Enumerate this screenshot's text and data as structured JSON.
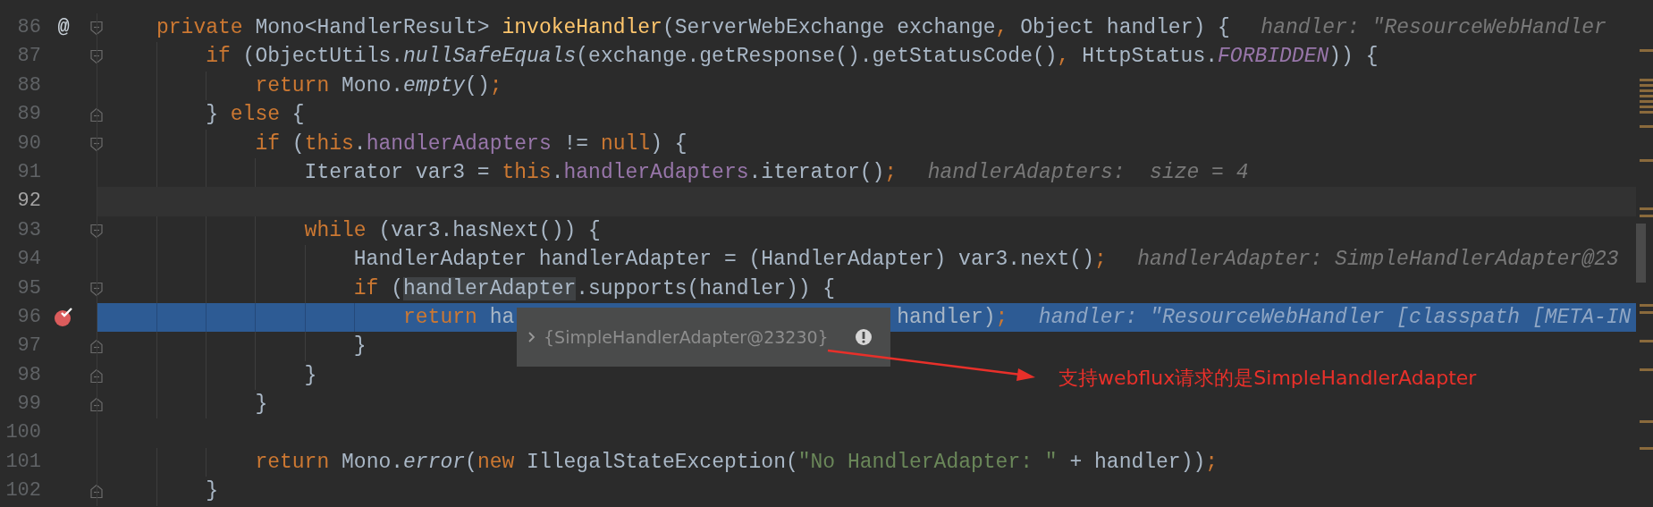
{
  "editor": {
    "lines": [
      {
        "number": "86",
        "gutter_mark": "@",
        "fold_start": true,
        "tokens": [
          {
            "kind": "kw",
            "text": "private"
          },
          {
            "kind": "txt",
            "text": " Mono<HandlerResult> "
          },
          {
            "kind": "decl",
            "text": "invokeHandler"
          },
          {
            "kind": "txt",
            "text": "(ServerWebExchange exchange"
          },
          {
            "kind": "punct",
            "text": ","
          },
          {
            "kind": "txt",
            "text": " Object handler) {"
          }
        ],
        "hint": "handler: \"ResourceWebHandler"
      },
      {
        "number": "87",
        "fold_start": true,
        "tokens": [
          {
            "kind": "kw",
            "text": "    if"
          },
          {
            "kind": "txt",
            "text": " (ObjectUtils."
          },
          {
            "kind": "static",
            "text": "nullSafeEquals"
          },
          {
            "kind": "txt",
            "text": "(exchange.getResponse().getStatusCode()"
          },
          {
            "kind": "punct",
            "text": ","
          },
          {
            "kind": "txt",
            "text": " HttpStatus."
          },
          {
            "kind": "constant",
            "text": "FORBIDDEN"
          },
          {
            "kind": "txt",
            "text": ")) {"
          }
        ]
      },
      {
        "number": "88",
        "tokens": [
          {
            "kind": "kw",
            "text": "        return"
          },
          {
            "kind": "txt",
            "text": " Mono."
          },
          {
            "kind": "static",
            "text": "empty"
          },
          {
            "kind": "txt",
            "text": "()"
          },
          {
            "kind": "punct",
            "text": ";"
          }
        ]
      },
      {
        "number": "89",
        "fold_end": true,
        "tokens": [
          {
            "kind": "txt",
            "text": "    } "
          },
          {
            "kind": "kw",
            "text": "else"
          },
          {
            "kind": "txt",
            "text": " {"
          }
        ]
      },
      {
        "number": "90",
        "fold_start": true,
        "tokens": [
          {
            "kind": "kw",
            "text": "        if"
          },
          {
            "kind": "txt",
            "text": " ("
          },
          {
            "kind": "kw",
            "text": "this"
          },
          {
            "kind": "txt",
            "text": "."
          },
          {
            "kind": "field",
            "text": "handlerAdapters"
          },
          {
            "kind": "txt",
            "text": " != "
          },
          {
            "kind": "kw",
            "text": "null"
          },
          {
            "kind": "txt",
            "text": ") {"
          }
        ]
      },
      {
        "number": "91",
        "tokens": [
          {
            "kind": "txt",
            "text": "            Iterator var3 = "
          },
          {
            "kind": "kw",
            "text": "this"
          },
          {
            "kind": "txt",
            "text": "."
          },
          {
            "kind": "field",
            "text": "handlerAdapters"
          },
          {
            "kind": "txt",
            "text": ".iterator()"
          },
          {
            "kind": "punct",
            "text": ";"
          }
        ],
        "hint": "handlerAdapters:  size = 4"
      },
      {
        "number": "92",
        "caret_line": true
      },
      {
        "number": "93",
        "fold_start": true,
        "tokens": [
          {
            "kind": "kw",
            "text": "            while"
          },
          {
            "kind": "txt",
            "text": " (var3.hasNext()) {"
          }
        ]
      },
      {
        "number": "94",
        "tokens": [
          {
            "kind": "txt",
            "text": "                HandlerAdapter handlerAdapter = (HandlerAdapter) var3.next()"
          },
          {
            "kind": "punct",
            "text": ";"
          }
        ],
        "hint": "handlerAdapter: SimpleHandlerAdapter@23"
      },
      {
        "number": "95",
        "fold_start": true,
        "tokens": [
          {
            "kind": "kw",
            "text": "                if"
          },
          {
            "kind": "txt",
            "text": " ("
          },
          {
            "kind": "hovered",
            "text": "handlerAdapter"
          },
          {
            "kind": "txt",
            "text": ".supports(handler)) {"
          }
        ]
      },
      {
        "number": "96",
        "execution_point": true,
        "breakpoint": true,
        "tokens": [
          {
            "kind": "kw",
            "text": "                    return"
          },
          {
            "kind": "txt",
            "text": " ha"
          },
          {
            "kind": "covered"
          },
          {
            "kind": "txt",
            "text": "handler)"
          },
          {
            "kind": "punct",
            "text": ";"
          }
        ],
        "hint": "handler: \"ResourceWebHandler [classpath [META-IN"
      },
      {
        "number": "97",
        "fold_end": true,
        "tokens": [
          {
            "kind": "txt",
            "text": "                }"
          }
        ]
      },
      {
        "number": "98",
        "fold_end": true,
        "tokens": [
          {
            "kind": "txt",
            "text": "            }"
          }
        ]
      },
      {
        "number": "99",
        "fold_end": true,
        "tokens": [
          {
            "kind": "txt",
            "text": "        }"
          }
        ]
      },
      {
        "number": "100"
      },
      {
        "number": "101",
        "tokens": [
          {
            "kind": "kw",
            "text": "        return"
          },
          {
            "kind": "txt",
            "text": " Mono."
          },
          {
            "kind": "static",
            "text": "error"
          },
          {
            "kind": "txt",
            "text": "("
          },
          {
            "kind": "kw",
            "text": "new"
          },
          {
            "kind": "txt",
            "text": " IllegalStateException("
          },
          {
            "kind": "str",
            "text": "\"No HandlerAdapter: \""
          },
          {
            "kind": "txt",
            "text": " + handler))"
          },
          {
            "kind": "punct",
            "text": ";"
          }
        ]
      },
      {
        "number": "102",
        "fold_end": true,
        "tokens": [
          {
            "kind": "txt",
            "text": "    }"
          }
        ]
      }
    ]
  },
  "value_popup": {
    "value": "{SimpleHandlerAdapter@23230}",
    "expandable": true
  },
  "annotation": {
    "text": "支持webflux请求的是SimpleHandlerAdapter"
  }
}
